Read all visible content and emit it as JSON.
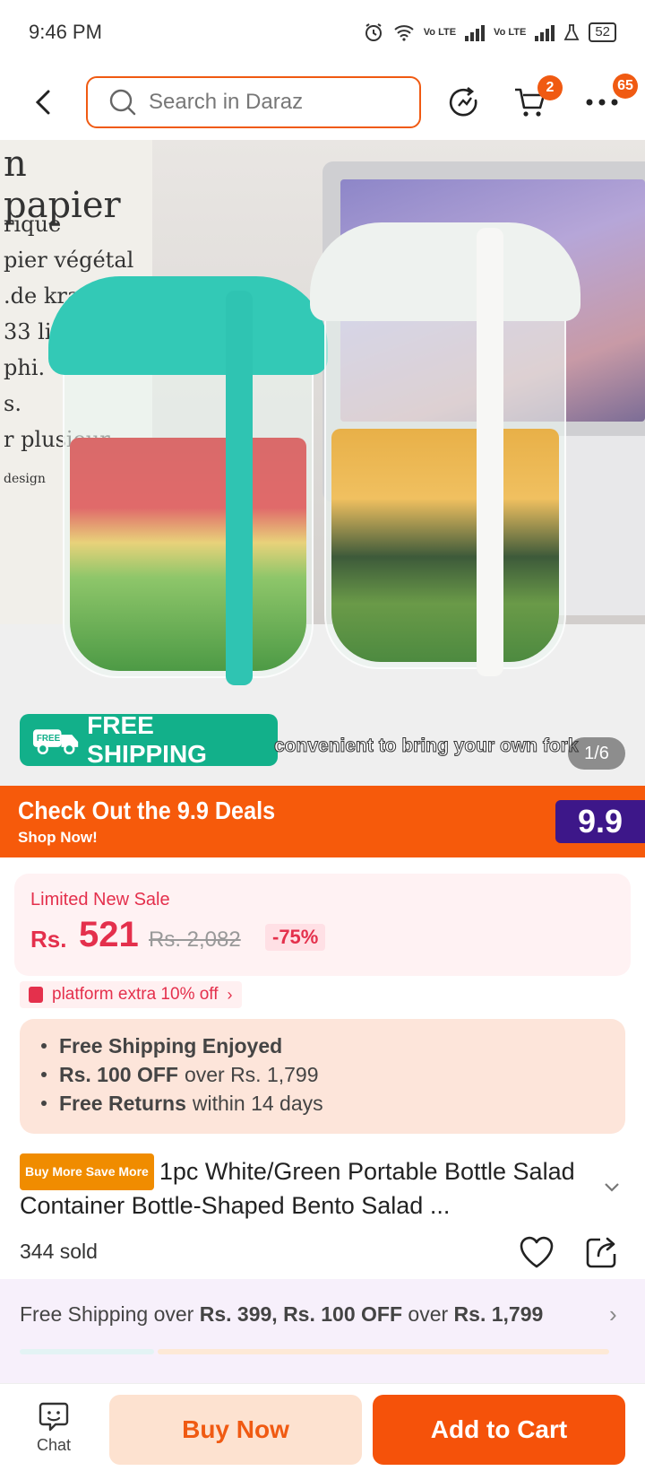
{
  "status_bar": {
    "time": "9:46 PM",
    "battery": "52",
    "lte1": "Vo LTE",
    "lte2": "Vo LTE"
  },
  "header": {
    "search_placeholder": "Search in Daraz",
    "cart_count": "2",
    "more_count": "65"
  },
  "hero": {
    "paper_lines": [
      "n papier",
      "rique",
      "pier végétal",
      ".de kraft",
      "33 litre",
      "phi.",
      "s.",
      "r plusieur",
      "design"
    ],
    "free_shipping_label": "FREE SHIPPING",
    "free_tag": "FREE",
    "caption": "convenient to bring your own fork",
    "image_counter": "1/6"
  },
  "deals_banner": {
    "title": "Check Out the 9.9 Deals",
    "subtitle": "Shop Now!",
    "logo": "9.9"
  },
  "price": {
    "label": "Limited New Sale",
    "currency": "Rs.",
    "current": "521",
    "original": "Rs. 2,082",
    "discount": "-75%"
  },
  "promo": {
    "label": "platform extra 10% off"
  },
  "benefits": [
    {
      "bold": "Free Shipping Enjoyed",
      "rest": ""
    },
    {
      "bold": "Rs. 100 OFF",
      "rest": "over Rs. 1,799"
    },
    {
      "bold": "Free Returns",
      "rest": "within 14 days"
    }
  ],
  "product": {
    "badge_buy_more": "Buy More",
    "badge_save_more": "Save More",
    "title": "1pc White/Green Portable Bottle Salad Container Bottle-Shaped Bento Salad ...",
    "sold": "344 sold"
  },
  "shipping_bar": {
    "prefix": "Free Shipping over",
    "threshold1": "Rs. 399, Rs. 100 OFF",
    "middle": "over",
    "threshold2": "Rs. 1,799"
  },
  "bottom_bar": {
    "chat_label": "Chat",
    "buy_now_label": "Buy Now",
    "add_to_cart_label": "Add to Cart"
  },
  "colors": {
    "brand_orange": "#f05a12",
    "price_red": "#e4304c",
    "shipping_green": "#12b08a",
    "deals_purple": "#3d1789"
  }
}
